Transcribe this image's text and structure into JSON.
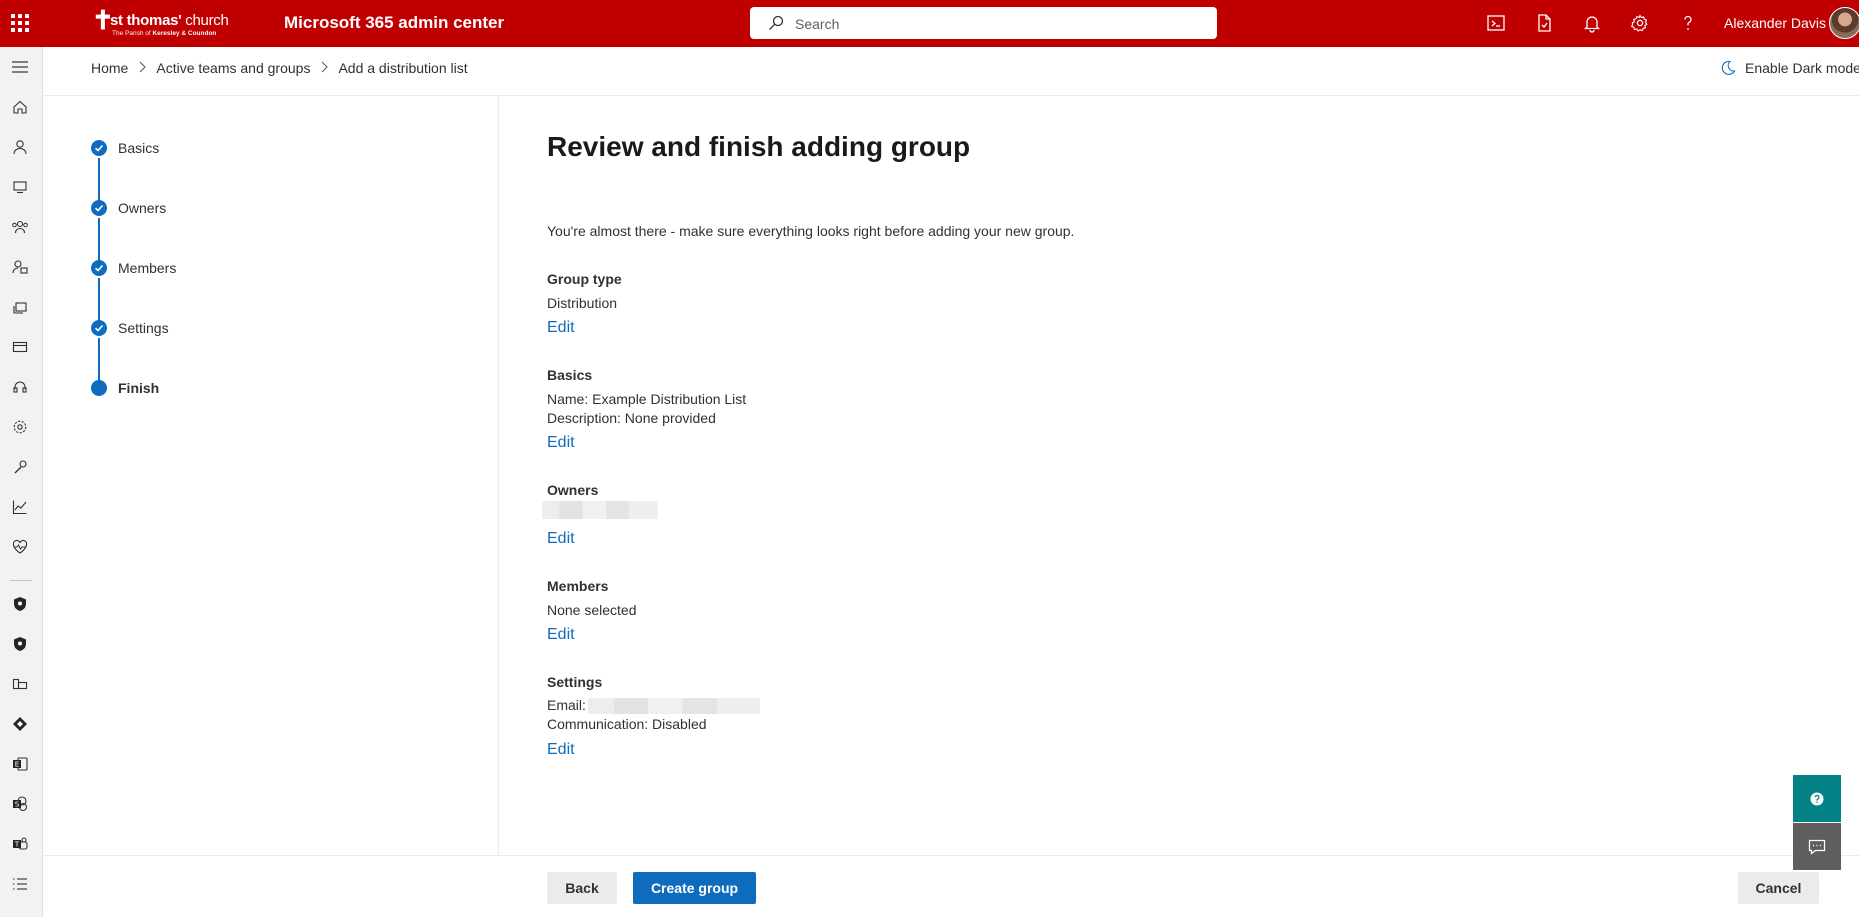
{
  "topbar": {
    "logo_mark": "✝",
    "logo_name_bold": "st thomas'",
    "logo_name_rest": " church",
    "logo_sub_prefix": "The Parish of ",
    "logo_sub_bold": "Keresley & Coundon",
    "app_title": "Microsoft 365 admin center",
    "search_placeholder": "Search",
    "user_name": "Alexander Davis",
    "icons": [
      "waffle-icon",
      "terminal-icon",
      "document-icon",
      "bell-icon",
      "gear-icon",
      "help-icon"
    ]
  },
  "breadcrumb": {
    "items": [
      "Home",
      "Active teams and groups",
      "Add a distribution list"
    ],
    "separator": ">"
  },
  "dark_mode_label": "Enable Dark mode",
  "steps": [
    {
      "label": "Basics",
      "state": "complete"
    },
    {
      "label": "Owners",
      "state": "complete"
    },
    {
      "label": "Members",
      "state": "complete"
    },
    {
      "label": "Settings",
      "state": "complete"
    },
    {
      "label": "Finish",
      "state": "current"
    }
  ],
  "page": {
    "title": "Review and finish adding group",
    "intro": "You're almost there - make sure everything looks right before adding your new group.",
    "sections": {
      "group_type": {
        "heading": "Group type",
        "value": "Distribution",
        "edit": "Edit"
      },
      "basics": {
        "heading": "Basics",
        "name": "Name: Example Distribution List",
        "description": "Description: None provided",
        "edit": "Edit"
      },
      "owners": {
        "heading": "Owners",
        "value_redacted": true,
        "edit": "Edit"
      },
      "members": {
        "heading": "Members",
        "value": "None selected",
        "edit": "Edit"
      },
      "settings": {
        "heading": "Settings",
        "email_label": "Email:",
        "email_redacted": true,
        "communication": "Communication: Disabled",
        "edit": "Edit"
      }
    }
  },
  "footer": {
    "back": "Back",
    "create": "Create group",
    "cancel": "Cancel"
  },
  "colors": {
    "topbar": "#c00000",
    "accent": "#0f6cbd",
    "help_fab": "#038387",
    "feedback_fab": "#605e5c"
  }
}
